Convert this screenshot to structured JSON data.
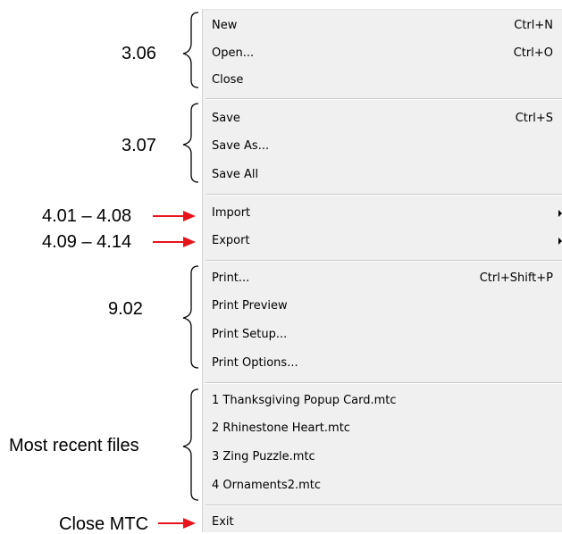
{
  "menu": {
    "items": [
      {
        "label": "New",
        "shortcut": "Ctrl+N"
      },
      {
        "label": "Open...",
        "shortcut": "Ctrl+O"
      },
      {
        "label": "Close",
        "shortcut": ""
      },
      {
        "label": "Save",
        "shortcut": "Ctrl+S"
      },
      {
        "label": "Save As...",
        "shortcut": ""
      },
      {
        "label": "Save All",
        "shortcut": ""
      },
      {
        "label": "Import",
        "shortcut": "",
        "submenu": true
      },
      {
        "label": "Export",
        "shortcut": "",
        "submenu": true
      },
      {
        "label": "Print...",
        "shortcut": "Ctrl+Shift+P"
      },
      {
        "label": "Print Preview",
        "shortcut": ""
      },
      {
        "label": "Print Setup...",
        "shortcut": ""
      },
      {
        "label": "Print Options...",
        "shortcut": ""
      },
      {
        "label": "1 Thanksgiving Popup Card.mtc",
        "shortcut": ""
      },
      {
        "label": "2 Rhinestone Heart.mtc",
        "shortcut": ""
      },
      {
        "label": "3 Zing Puzzle.mtc",
        "shortcut": ""
      },
      {
        "label": "4 Ornaments2.mtc",
        "shortcut": ""
      },
      {
        "label": "Exit",
        "shortcut": ""
      }
    ]
  },
  "annotations": {
    "file_ops": "3.06",
    "save_ops": "3.07",
    "import": "4.01 – 4.08",
    "export": "4.09 – 4.14",
    "print_ops": "9.02",
    "recent": "Most recent files",
    "exit": "Close MTC"
  },
  "colors": {
    "arrow": "#e8141b",
    "menu_bg": "#f0f0f0",
    "separator": "#c8c8c8"
  }
}
